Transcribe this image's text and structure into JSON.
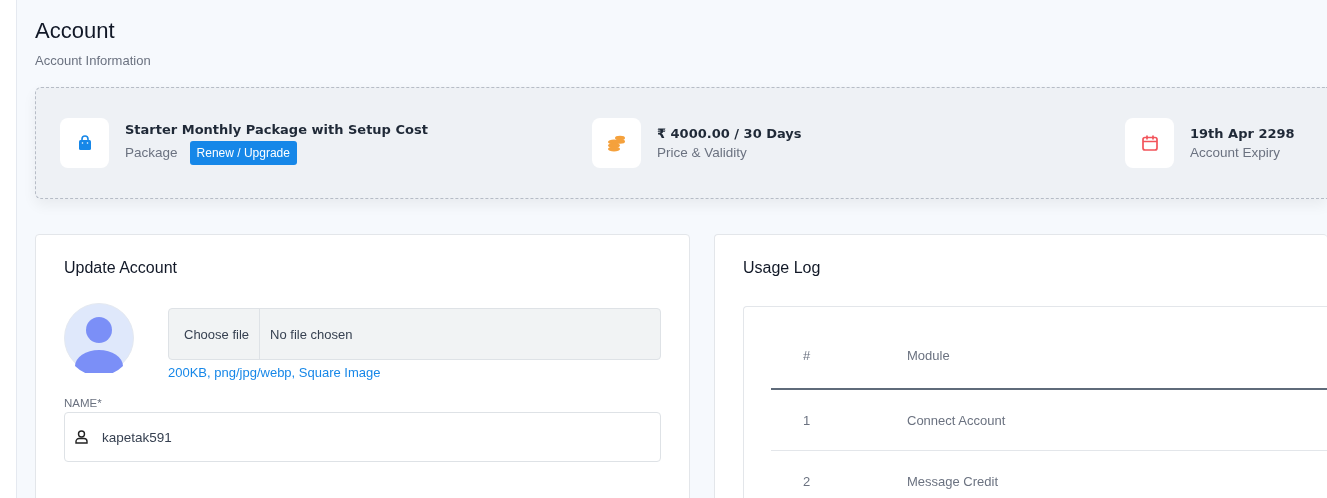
{
  "header": {
    "title": "Account",
    "subtitle": "Account Information"
  },
  "summary": [
    {
      "kind": "package",
      "value": "Starter Monthly Package with Setup Cost",
      "label": "Package",
      "button": "Renew / Upgrade"
    },
    {
      "kind": "price",
      "value": "₹ 4000.00 / 30 Days",
      "label": "Price & Validity"
    },
    {
      "kind": "expiry",
      "value": "19th Apr 2298",
      "label": "Account Expiry"
    }
  ],
  "update_account": {
    "title": "Update Account",
    "file_button": "Choose file",
    "file_status": "No file chosen",
    "file_hint": "200KB, png/jpg/webp, Square Image",
    "name_label": "NAME*",
    "name_value": "kapetak591"
  },
  "usage_log": {
    "title": "Usage Log",
    "columns": [
      "#",
      "Module"
    ],
    "rows": [
      [
        "1",
        "Connect Account"
      ],
      [
        "2",
        "Message Credit"
      ]
    ]
  }
}
